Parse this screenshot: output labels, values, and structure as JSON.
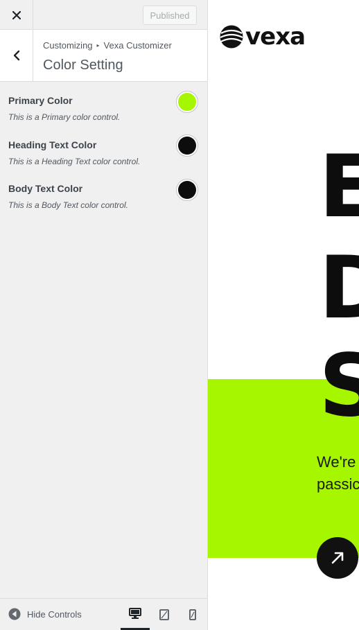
{
  "topbar": {
    "close_icon": "close-icon",
    "publish_label": "Published"
  },
  "section": {
    "back_icon": "chevron-left-icon",
    "breadcrumb_root": "Customizing",
    "breadcrumb_sep": "▸",
    "breadcrumb_panel": "Vexa Customizer",
    "title": "Color Setting"
  },
  "controls": [
    {
      "label": "Primary Color",
      "description": "This is a Primary color control.",
      "color": "#a6f600"
    },
    {
      "label": "Heading Text Color",
      "description": "This is a Heading Text color control.",
      "color": "#0d0d0d"
    },
    {
      "label": "Body Text Color",
      "description": "This is a Body Text color control.",
      "color": "#0d0d0d"
    }
  ],
  "footer": {
    "hide_controls_label": "Hide Controls",
    "devices": [
      "desktop-icon",
      "tablet-icon",
      "mobile-icon"
    ],
    "active_device": "desktop"
  },
  "preview": {
    "logo_text": "vexa",
    "hero_letters": [
      "E",
      "D",
      "S"
    ],
    "hero_sub_line1": "We're",
    "hero_sub_line2": "passic",
    "accent_color": "#a6f600"
  }
}
